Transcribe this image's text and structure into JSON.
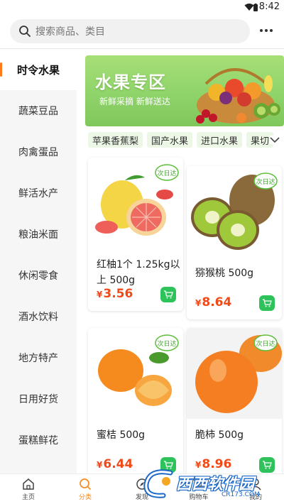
{
  "status_bar": {
    "time": "8:42"
  },
  "search": {
    "placeholder": "搜索商品、类目"
  },
  "sidebar": {
    "items": [
      {
        "label": "时令水果",
        "active": true
      },
      {
        "label": "蔬菜豆品"
      },
      {
        "label": "肉禽蛋品"
      },
      {
        "label": "鲜活水产"
      },
      {
        "label": "粮油米面"
      },
      {
        "label": "休闲零食"
      },
      {
        "label": "酒水饮料"
      },
      {
        "label": "地方特产"
      },
      {
        "label": "日用好货"
      },
      {
        "label": "蛋糕鲜花"
      }
    ]
  },
  "banner": {
    "title": "水果专区",
    "subtitle": "新鲜采摘  新鲜送达"
  },
  "chips": [
    "苹果香蕉梨",
    "国产水果",
    "进口水果",
    "果切"
  ],
  "badge_text": "次日达",
  "products": [
    {
      "name": "红柚1个 1.25kg以上 500g",
      "currency": "¥",
      "price": "3.56"
    },
    {
      "name": "猕猴桃 500g",
      "currency": "¥",
      "price": "8.64"
    },
    {
      "name": "蜜桔 500g",
      "currency": "¥",
      "price": "6.44"
    },
    {
      "name": "脆柿 500g",
      "currency": "¥",
      "price": "8.96"
    }
  ],
  "tabbar": {
    "items": [
      {
        "label": "主页",
        "icon": "home-icon"
      },
      {
        "label": "分类",
        "icon": "search-icon",
        "active": true
      },
      {
        "label": "发现",
        "icon": "discover-icon"
      },
      {
        "label": "购物车",
        "icon": "cart-icon"
      },
      {
        "label": "我的",
        "icon": "user-icon"
      }
    ]
  },
  "watermark": {
    "text": "西西软件园",
    "url": "CR173.COM"
  },
  "colors": {
    "accent": "#f58a1f",
    "price": "#f04a18",
    "cart": "#2dc25a",
    "banner": "#8fd36b"
  }
}
